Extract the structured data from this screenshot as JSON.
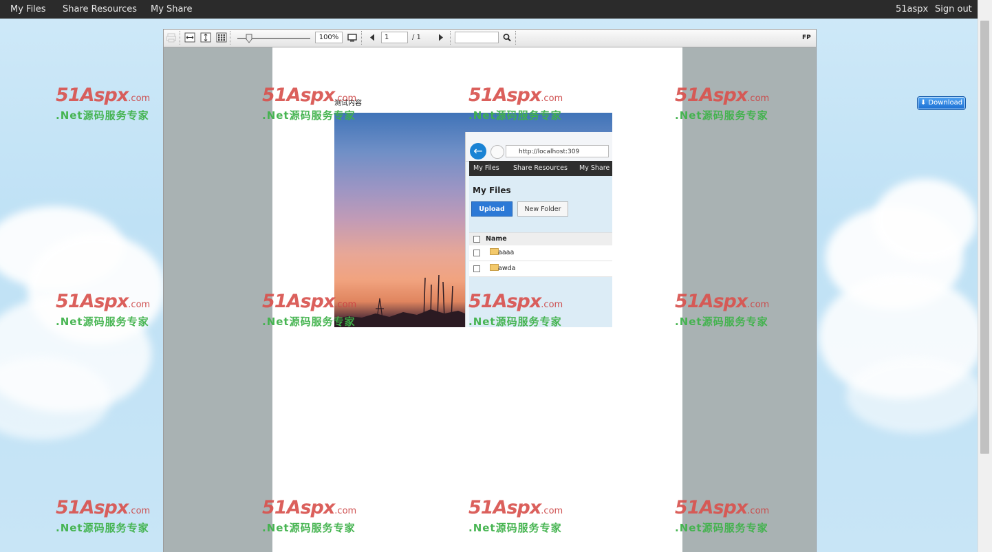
{
  "top_nav": {
    "left_items": [
      "My Files",
      "Share Resources",
      "My Share"
    ],
    "user": "51aspx",
    "sign_out": "Sign out"
  },
  "viewer_toolbar": {
    "zoom": "100%",
    "page_current": "1",
    "page_total": "/ 1",
    "search_value": "",
    "brand": "FP",
    "icons": [
      "print-icon",
      "fit-width-icon",
      "fit-height-icon",
      "thumbnails-icon",
      "zoom-slider",
      "fullscreen-icon",
      "prev-page-icon",
      "next-page-icon",
      "search-icon"
    ]
  },
  "document": {
    "text_line": "测试内容",
    "embedded_screenshot": {
      "url": "http://localhost:309",
      "nav": [
        "My Files",
        "Share Resources",
        "My Share"
      ],
      "title": "My Files",
      "upload": "Upload",
      "new_folder": "New Folder",
      "column_name": "Name",
      "rows": [
        "aaaa",
        "awda"
      ]
    }
  },
  "watermark": {
    "logo": "51Aspx",
    "logo_suffix": ".com",
    "tagline": ".Net源码服务专家"
  },
  "download_button": "Download",
  "colors": {
    "nav_bg": "#2b2b2b",
    "download_blue": "#1a6fd3",
    "watermark_red": "#d9534f",
    "watermark_green": "#3fb24a"
  }
}
